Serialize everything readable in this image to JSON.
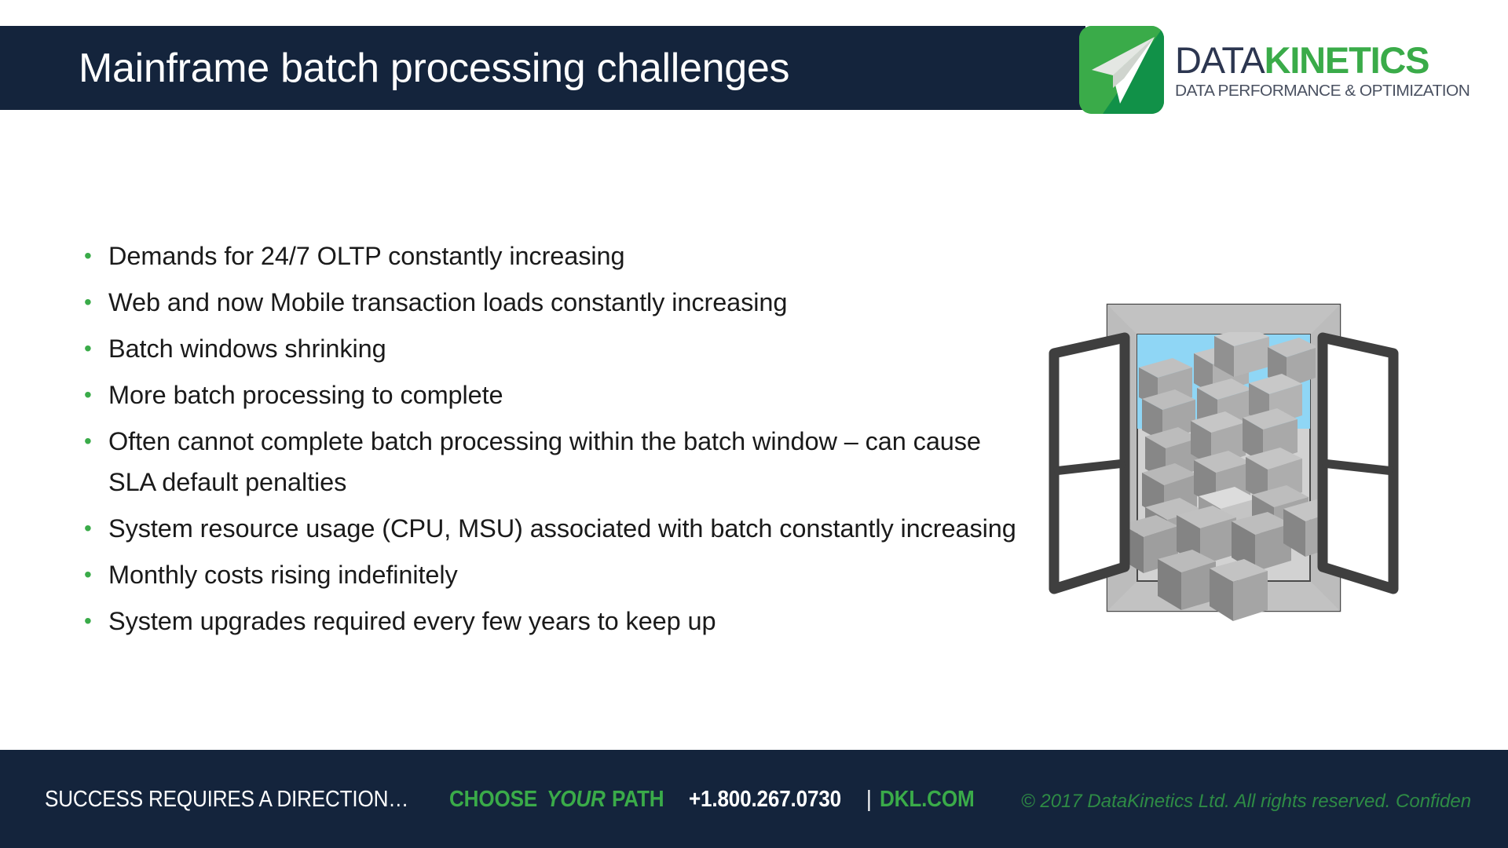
{
  "slide": {
    "title": "Mainframe batch processing challenges",
    "colors": {
      "header_navy": "#14243c",
      "brand_green": "#3aab49",
      "footer_navy": "#14243c",
      "body_text": "#1a1a1a",
      "copyright_green": "#2e8b45",
      "sky_blue": "#8fd6f5"
    }
  },
  "logo": {
    "mark_name": "paper-plane-arrow",
    "word_data": "DATA",
    "word_kinetics": "KINETICS",
    "tagline": "DATA PERFORMANCE & OPTIMIZATION"
  },
  "content": {
    "bullet_char": "•",
    "bullets": [
      "Demands for 24/7 OLTP constantly increasing",
      "Web and now Mobile transaction loads constantly increasing",
      "Batch windows shrinking",
      "More batch processing to complete",
      "Often cannot complete batch processing within the batch window – can cause SLA default penalties",
      "System resource usage (CPU, MSU) associated with batch constantly increasing",
      "Monthly costs rising indefinitely",
      "System upgrades required every few years to keep up"
    ]
  },
  "illustration": {
    "name": "open-window-overflowing-with-blocks",
    "description": "Open casement window with grey 3D cubes spilling out, blue sky behind"
  },
  "footer": {
    "tagline": "SUCCESS REQUIRES A DIRECTION… ",
    "choose": "CHOOSE ",
    "your": "YOUR",
    "path": " PATH",
    "phone": "+1.800.267.0730",
    "separator": "|",
    "url": "DKL.COM",
    "copyright": "© 2017 DataKinetics Ltd.   All rights reserved. Confiden"
  }
}
